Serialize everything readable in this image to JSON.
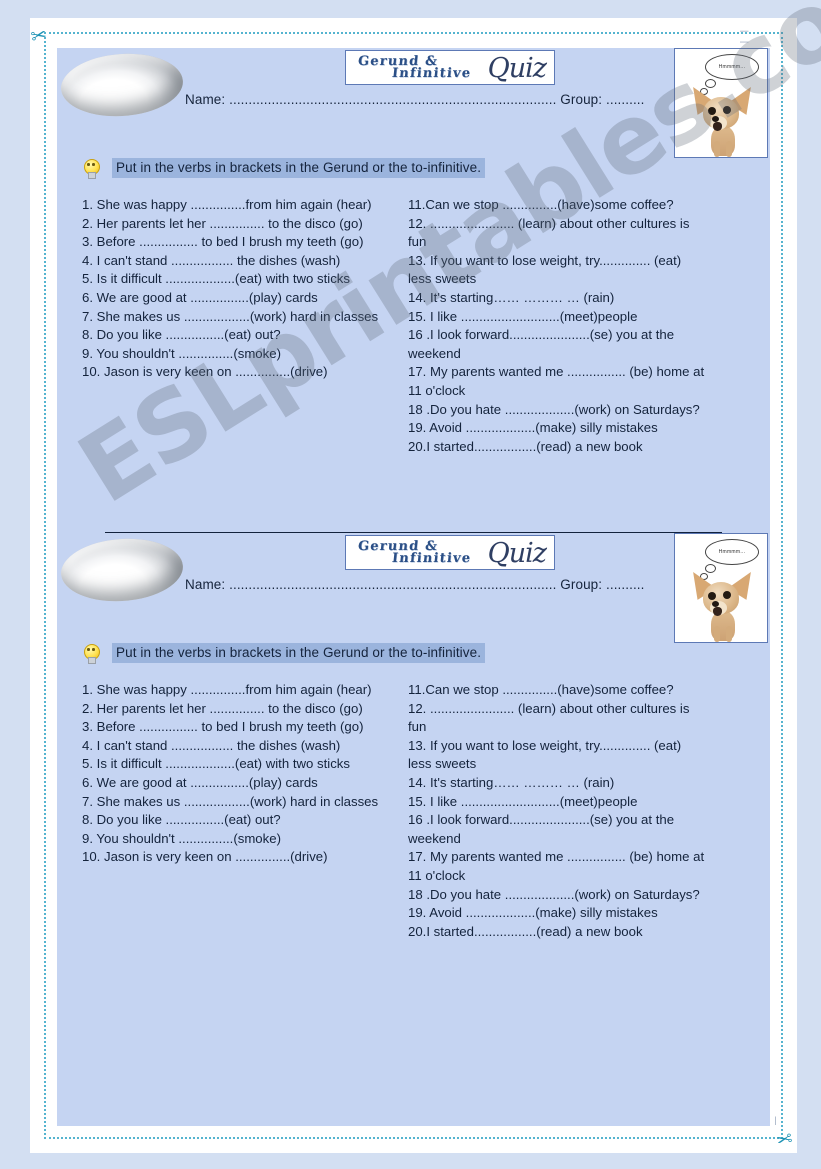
{
  "document": {
    "watermark": "ESLprintables.com",
    "divider_present": true
  },
  "decor": {
    "scissors_icon": "scissors-icon",
    "tick_marks_top": "| | | |",
    "tick_marks_bottom": "| | | | |"
  },
  "worksheet": {
    "title": {
      "line1": "Gerund &",
      "line2": "Infinitive",
      "script": "Quiz"
    },
    "name_line": "Name: ..................................................................................... Group: ..........",
    "instruction": "Put in the verbs in brackets in the Gerund or the to-infinitive.",
    "bulb_icon": "lightbulb-icon",
    "dog_image": {
      "icon": "chihuahua-dog-photo",
      "thought_bubble": "Hmmmm..."
    },
    "questions_left": [
      "1. She was happy ...............from him again (hear)",
      "2. Her parents let her ............... to the disco (go)",
      "3. Before ................ to bed I brush my teeth (go)",
      "4. I can't stand ................. the dishes (wash)",
      "5. Is it difficult  ...................(eat) with two sticks",
      "6. We are good at  ................(play) cards",
      "7. She makes us  ..................(work) hard in classes",
      "8. Do you like  ................(eat) out?",
      "9. You shouldn't ...............(smoke)",
      "10. Jason is very keen on ...............(drive)"
    ],
    "questions_right": [
      "11.Can we stop ...............(have)some coffee?",
      "12. ....................... (learn) about other cultures is fun",
      "13. If you want to lose weight, try.............. (eat) less sweets",
      "14. It's starting…… ……… … (rain)",
      "15. I like ...........................(meet)people",
      "16 .I look forward......................(se) you at the weekend",
      "17. My parents wanted me ................ (be) home at 11 o'clock",
      "18 .Do you hate ...................(work) on Saturdays?",
      "19. Avoid ...................(make) silly mistakes",
      "20.I started.................(read) a new book"
    ]
  },
  "colors": {
    "sheet_background": "#c5d4f2",
    "page_margin": "#d3dff2",
    "instruction_highlight": "#9bb4dd",
    "text": "#14233c",
    "accent_border": "#5d79b5",
    "cut_line": "#55b4cf"
  }
}
